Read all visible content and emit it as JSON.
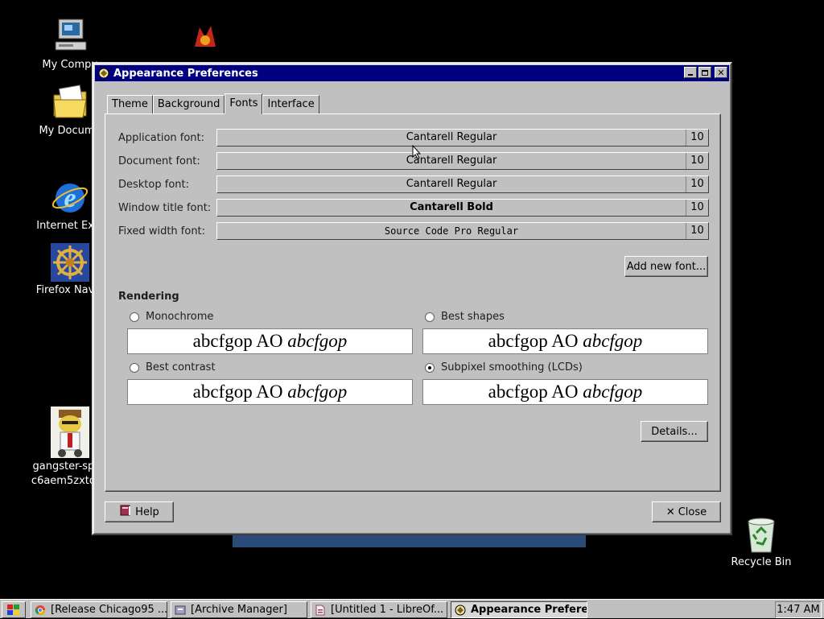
{
  "desktop": {
    "icons": [
      {
        "label": "My Compu",
        "icon": "computer-icon"
      },
      {
        "label": "My Docume",
        "icon": "folder-icon"
      },
      {
        "label": "Internet Expl",
        "icon": "internet-explorer-icon"
      },
      {
        "label": "Firefox Navig",
        "icon": "ships-wheel-icon"
      },
      {
        "label": "gangster-spon",
        "label2": "c6aem5zxtdv0",
        "icon": "gangster-image-icon"
      },
      {
        "label": "Recycle Bin",
        "icon": "recycle-bin-icon"
      }
    ]
  },
  "window": {
    "title": "Appearance Preferences",
    "tabs": [
      "Theme",
      "Background",
      "Fonts",
      "Interface"
    ],
    "active_tab": "Fonts",
    "fonts": [
      {
        "label": "Application font:",
        "name": "Cantarell Regular",
        "size": "10"
      },
      {
        "label": "Document font:",
        "name": "Cantarell Regular",
        "size": "10"
      },
      {
        "label": "Desktop font:",
        "name": "Cantarell Regular",
        "size": "10"
      },
      {
        "label": "Window title font:",
        "name": "Cantarell Bold",
        "size": "10"
      },
      {
        "label": "Fixed width font:",
        "name": "Source Code Pro Regular",
        "size": "10"
      }
    ],
    "add_font_label": "Add new font...",
    "rendering": {
      "title": "Rendering",
      "sample_plain": "abcfgop AO ",
      "sample_italic": "abcfgop",
      "options": [
        {
          "label": "Monochrome",
          "selected": false
        },
        {
          "label": "Best shapes",
          "selected": false
        },
        {
          "label": "Best contrast",
          "selected": false
        },
        {
          "label": "Subpixel smoothing (LCDs)",
          "selected": true
        }
      ]
    },
    "details_label": "Details...",
    "help_label": "Help",
    "close_label": "Close"
  },
  "taskbar": {
    "tasks": [
      {
        "label": "[Release Chicago95 ...",
        "icon": "chrome-icon",
        "active": false
      },
      {
        "label": "[Archive Manager]",
        "icon": "archive-icon",
        "active": false
      },
      {
        "label": "[Untitled 1 - LibreOf...",
        "icon": "libreoffice-icon",
        "active": false
      },
      {
        "label": "Appearance Prefere...",
        "icon": "appearance-icon",
        "active": true
      }
    ],
    "clock": "1:47 AM"
  },
  "colors": {
    "titlebar": "#000080",
    "face": "#c0c0c0",
    "desktop": "#000000"
  }
}
